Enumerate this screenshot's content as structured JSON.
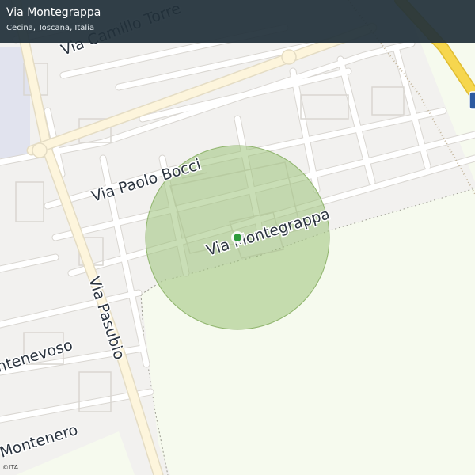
{
  "header": {
    "title": "Via Montegrappa",
    "subtitle": "Cecina, Toscana, Italia"
  },
  "map": {
    "colors": {
      "land": "#f2f1ef",
      "open_area": "#f6faee",
      "road": "#ffffff",
      "road_casing": "#d9d6d1",
      "primary_road": "#fdf5dc",
      "highway": "#f6d64e",
      "railway": "#c2b49a",
      "block_area": "#e1e3ee",
      "accuracy_circle": "#9cc27a",
      "location_dot": "#2e9c3c"
    },
    "street_labels": {
      "via_montegrappa": "Via Montegrappa",
      "via_paolo_bocci": "Via  Paolo  Bocci",
      "via_pasubio": "Via Pasubio",
      "via_camillo": "Via Camillo  Torre",
      "via_montenevoso": "ntenevoso",
      "via_montenero": "Montenero"
    },
    "icons": {
      "location_marker": "location-dot-icon",
      "highway_shield": "route-shield-icon"
    }
  },
  "attribution": "©ITA"
}
